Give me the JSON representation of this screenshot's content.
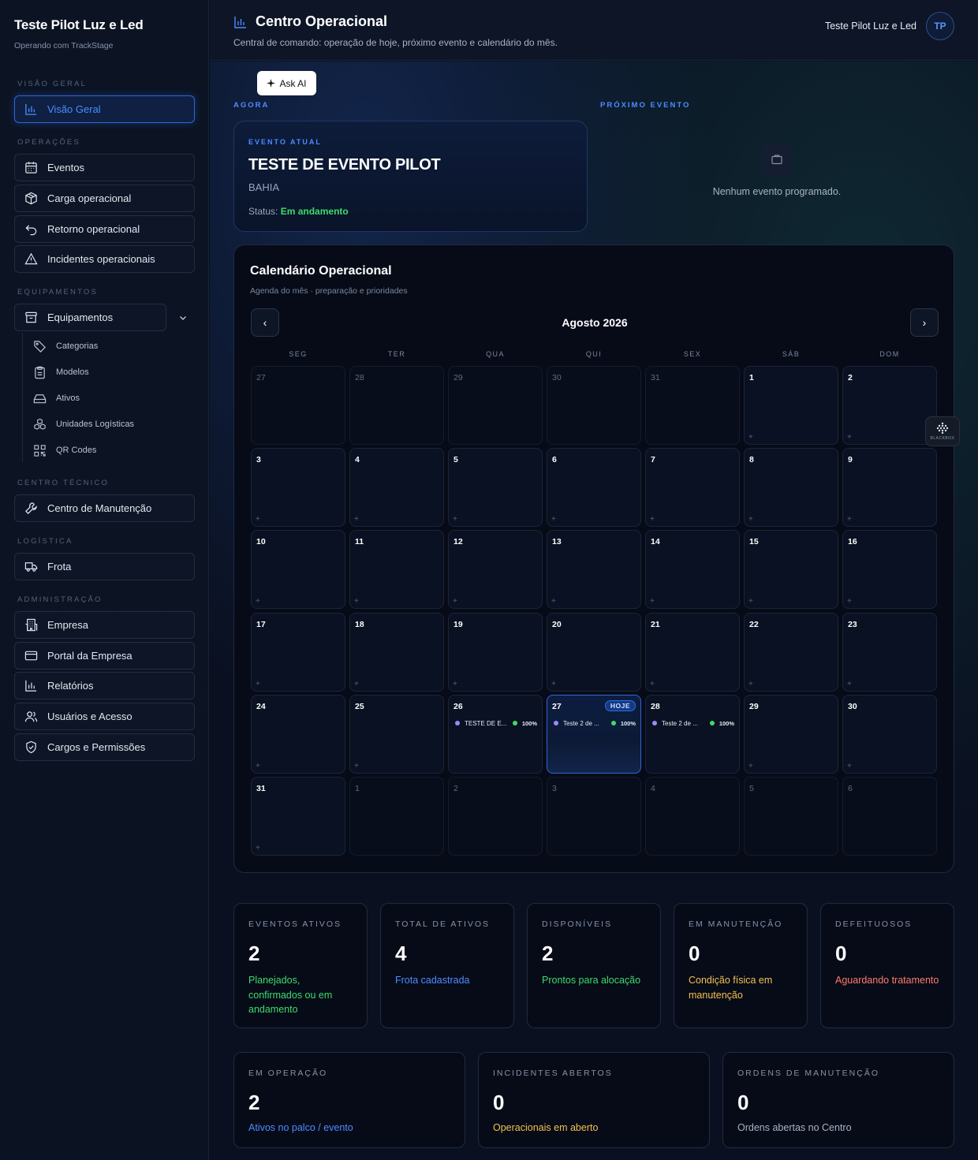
{
  "sidebar": {
    "brand_title": "Teste Pilot Luz e Led",
    "brand_sub": "Operando com TrackStage",
    "sections": {
      "visao_geral": "VISÃO GERAL",
      "operacoes": "OPERAÇÕES",
      "equipamentos": "EQUIPAMENTOS",
      "centro_tecnico": "CENTRO TÉCNICO",
      "logistica": "LOGÍSTICA",
      "administracao": "ADMINISTRAÇÃO"
    },
    "items": {
      "visao_geral": "Visão Geral",
      "eventos": "Eventos",
      "carga": "Carga operacional",
      "retorno": "Retorno operacional",
      "incidentes": "Incidentes operacionais",
      "equipamentos": "Equipamentos",
      "centro_manutencao": "Centro de Manutenção",
      "frota": "Frota",
      "empresa": "Empresa",
      "portal": "Portal da Empresa",
      "relatorios": "Relatórios",
      "usuarios": "Usuários e Acesso",
      "cargos": "Cargos e Permissões"
    },
    "subitems": {
      "categorias": "Categorias",
      "modelos": "Modelos",
      "ativos": "Ativos",
      "unidades": "Unidades Logísticas",
      "qr": "QR Codes"
    }
  },
  "header": {
    "title": "Centro Operacional",
    "subtitle": "Central de comando: operação de hoje, próximo evento e calendário do mês.",
    "user_name": "Teste Pilot Luz e Led",
    "avatar_initials": "TP"
  },
  "ask_ai": "Ask AI",
  "agora": {
    "kicker": "AGORA",
    "card_kicker": "EVENTO ATUAL",
    "event_title": "TESTE DE EVENTO PILOT",
    "location": "BAHIA",
    "status_label": "Status:",
    "status_value": "Em andamento"
  },
  "proximo": {
    "kicker": "PRÓXIMO EVENTO",
    "empty_text": "Nenhum evento programado."
  },
  "calendar": {
    "title": "Calendário Operacional",
    "subtitle": "Agenda do mês · preparação e prioridades",
    "month": "Agosto 2026",
    "prev": "‹",
    "next": "›",
    "today_badge": "HOJE",
    "weekdays": [
      "SEG",
      "TER",
      "QUA",
      "QUI",
      "SEX",
      "SÁB",
      "DOM"
    ],
    "weeks": [
      [
        {
          "d": "27",
          "o": true
        },
        {
          "d": "28",
          "o": true
        },
        {
          "d": "29",
          "o": true
        },
        {
          "d": "30",
          "o": true
        },
        {
          "d": "31",
          "o": true
        },
        {
          "d": "1"
        },
        {
          "d": "2"
        }
      ],
      [
        {
          "d": "3"
        },
        {
          "d": "4"
        },
        {
          "d": "5"
        },
        {
          "d": "6"
        },
        {
          "d": "7"
        },
        {
          "d": "8"
        },
        {
          "d": "9"
        }
      ],
      [
        {
          "d": "10"
        },
        {
          "d": "11"
        },
        {
          "d": "12"
        },
        {
          "d": "13"
        },
        {
          "d": "14"
        },
        {
          "d": "15"
        },
        {
          "d": "16"
        }
      ],
      [
        {
          "d": "17"
        },
        {
          "d": "18"
        },
        {
          "d": "19"
        },
        {
          "d": "20"
        },
        {
          "d": "21"
        },
        {
          "d": "22"
        },
        {
          "d": "23"
        }
      ],
      [
        {
          "d": "24"
        },
        {
          "d": "25"
        },
        {
          "d": "26",
          "ev": "TESTE DE E...",
          "pct": "100%"
        },
        {
          "d": "27",
          "today": true,
          "ev": "Teste 2 de ...",
          "pct": "100%"
        },
        {
          "d": "28",
          "ev": "Teste 2 de ...",
          "pct": "100%"
        },
        {
          "d": "29"
        },
        {
          "d": "30"
        }
      ],
      [
        {
          "d": "31"
        },
        {
          "d": "1",
          "o": true
        },
        {
          "d": "2",
          "o": true
        },
        {
          "d": "3",
          "o": true
        },
        {
          "d": "4",
          "o": true
        },
        {
          "d": "5",
          "o": true
        },
        {
          "d": "6",
          "o": true
        }
      ]
    ]
  },
  "stats_row1": [
    {
      "label": "EVENTOS ATIVOS",
      "value": "2",
      "desc": "Planejados, confirmados ou em andamento",
      "color": "#3ddc6a"
    },
    {
      "label": "TOTAL DE ATIVOS",
      "value": "4",
      "desc": "Frota cadastrada",
      "color": "#4d8cff"
    },
    {
      "label": "DISPONÍVEIS",
      "value": "2",
      "desc": "Prontos para alocação",
      "color": "#3ddc6a"
    },
    {
      "label": "EM MANUTENÇÃO",
      "value": "0",
      "desc": "Condição física em manutenção",
      "color": "#f2c14e"
    },
    {
      "label": "DEFEITUOSOS",
      "value": "0",
      "desc": "Aguardando tratamento",
      "color": "#ff7a6b"
    }
  ],
  "stats_row2": [
    {
      "label": "EM OPERAÇÃO",
      "value": "2",
      "desc": "Ativos no palco / evento",
      "color": "#4d8cff"
    },
    {
      "label": "INCIDENTES ABERTOS",
      "value": "0",
      "desc": "Operacionais em aberto",
      "color": "#f2c14e"
    },
    {
      "label": "ORDENS DE MANUTENÇÃO",
      "value": "0",
      "desc": "Ordens abertas no Centro",
      "color": "#a8b3c4"
    }
  ]
}
